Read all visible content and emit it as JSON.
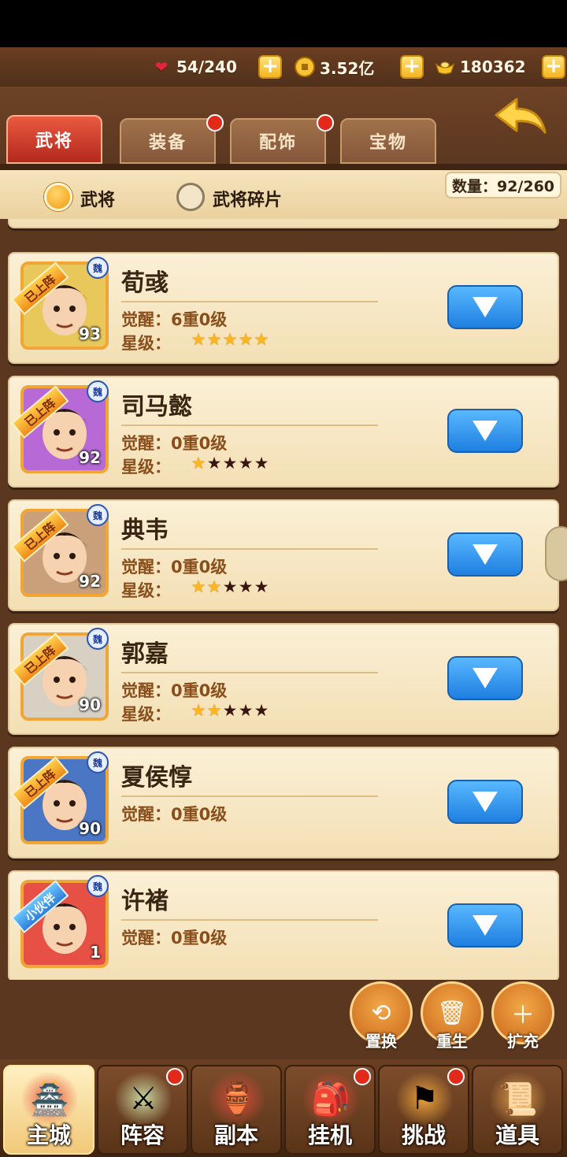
{
  "resources": {
    "stamina": "54/240",
    "coins": "3.52亿",
    "gold": "180362",
    "plus": "+"
  },
  "tabs": [
    {
      "label": "武将",
      "active": true,
      "badge": false
    },
    {
      "label": "装备",
      "active": false,
      "badge": true
    },
    {
      "label": "配饰",
      "active": false,
      "badge": true
    },
    {
      "label": "宝物",
      "active": false,
      "badge": false
    }
  ],
  "filter": {
    "option1": "武将",
    "option2": "武将碎片",
    "count": "数量：92/260"
  },
  "heroes": [
    {
      "name": "荀彧",
      "awaken": "觉醒：6重0级",
      "star_label": "星级：",
      "stars_full": 5,
      "level": "93",
      "faction": "魏",
      "tag": "已上阵",
      "tag_type": "deployed",
      "portrait_color": "#e8c85a",
      "show_stars": true
    },
    {
      "name": "司马懿",
      "awaken": "觉醒：0重0级",
      "star_label": "星级：",
      "stars_full": 1,
      "level": "92",
      "faction": "魏",
      "tag": "已上阵",
      "tag_type": "deployed",
      "portrait_color": "#b76ad6",
      "show_stars": true
    },
    {
      "name": "典韦",
      "awaken": "觉醒：0重0级",
      "star_label": "星级：",
      "stars_full": 2,
      "level": "92",
      "faction": "魏",
      "tag": "已上阵",
      "tag_type": "deployed",
      "portrait_color": "#c9a07a",
      "show_stars": true
    },
    {
      "name": "郭嘉",
      "awaken": "觉醒：0重0级",
      "star_label": "星级：",
      "stars_full": 2,
      "level": "90",
      "faction": "魏",
      "tag": "已上阵",
      "tag_type": "deployed",
      "portrait_color": "#d9d0c4",
      "show_stars": true
    },
    {
      "name": "夏侯惇",
      "awaken": "觉醒：0重0级",
      "star_label": "",
      "stars_full": 0,
      "level": "90",
      "faction": "魏",
      "tag": "已上阵",
      "tag_type": "deployed",
      "portrait_color": "#4a76c4",
      "show_stars": false
    },
    {
      "name": "许褚",
      "awaken": "觉醒：0重0级",
      "star_label": "",
      "stars_full": 0,
      "level": "1",
      "faction": "魏",
      "tag": "小伙伴",
      "tag_type": "partner",
      "portrait_color": "#e75045",
      "show_stars": false
    }
  ],
  "actions": [
    {
      "label": "置换",
      "icon": "swap-icon"
    },
    {
      "label": "重生",
      "icon": "trash-icon"
    },
    {
      "label": "扩充",
      "icon": "expand-bag-icon"
    }
  ],
  "nav": [
    {
      "label": "主城",
      "icon": "castle-icon",
      "active": true,
      "badge": false
    },
    {
      "label": "阵容",
      "icon": "lineup-icon",
      "active": false,
      "badge": true
    },
    {
      "label": "副本",
      "icon": "dungeon-icon",
      "active": false,
      "badge": false
    },
    {
      "label": "挂机",
      "icon": "idle-icon",
      "active": false,
      "badge": true
    },
    {
      "label": "挑战",
      "icon": "challenge-icon",
      "active": false,
      "badge": true
    },
    {
      "label": "道具",
      "icon": "items-icon",
      "active": false,
      "badge": false
    }
  ]
}
